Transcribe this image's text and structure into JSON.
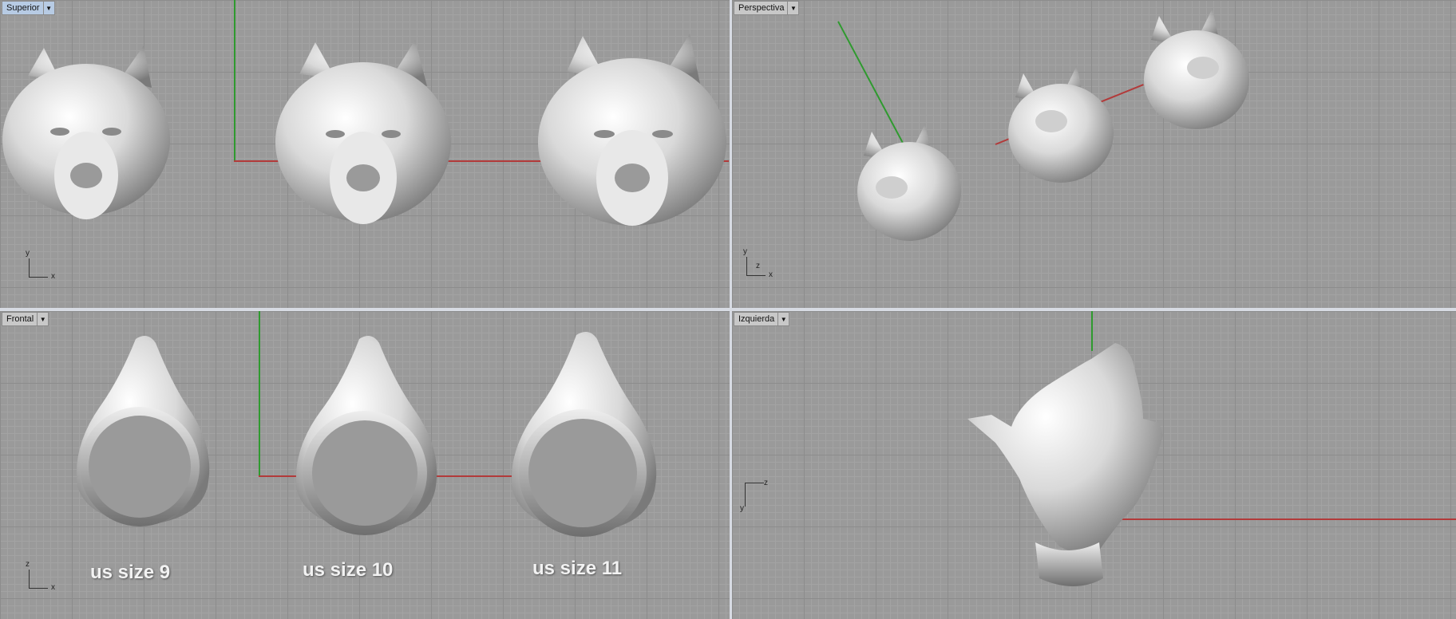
{
  "viewports": {
    "top": {
      "name": "Superior",
      "axis1": "y",
      "axis2": "x"
    },
    "perspective": {
      "name": "Perspectiva",
      "axis1": "y",
      "axis2": "x",
      "axis3": "z"
    },
    "front": {
      "name": "Frontal",
      "axis1": "z",
      "axis2": "x"
    },
    "left": {
      "name": "Izquierda",
      "axis1": "y",
      "axis2": "z"
    }
  },
  "ring_sizes": [
    "us size 9",
    "us size 10",
    "us size 11"
  ],
  "icons": {
    "viewport_menu": "chevron-down-icon"
  },
  "colors": {
    "x_axis": "#b23a3a",
    "y_axis": "#2f9a2f",
    "active_tab": "#b7cbe4"
  }
}
